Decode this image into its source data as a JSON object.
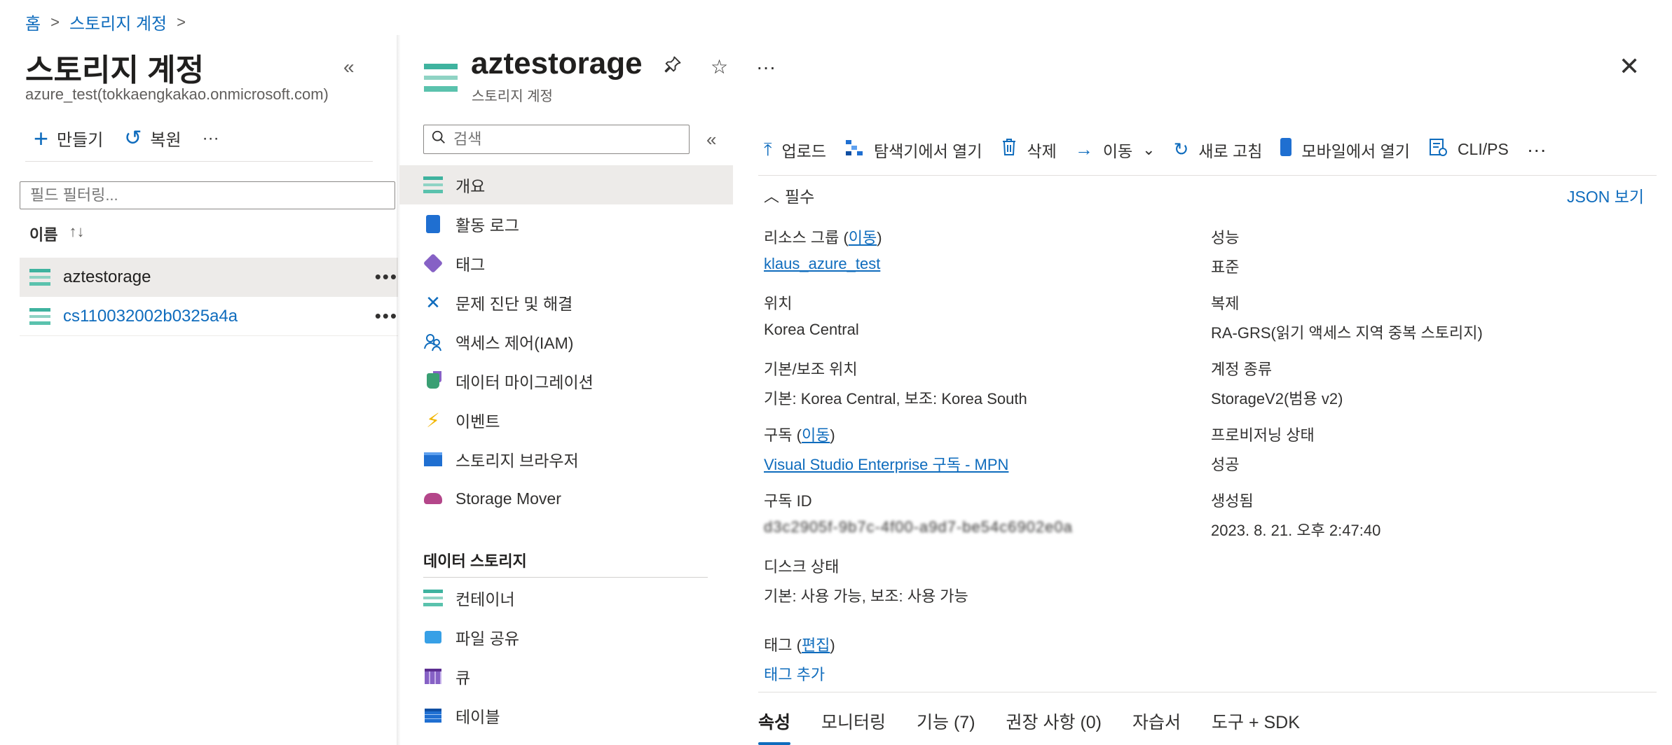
{
  "breadcrumb": {
    "home": "홈",
    "storage_accounts": "스토리지 계정"
  },
  "left_pane": {
    "title": "스토리지 계정",
    "tenant": "azure_test(tokkaengkakao.onmicrosoft.com)",
    "create_label": "만들기",
    "restore_label": "복원",
    "more": "···",
    "filter_placeholder": "필드 필터링...",
    "column_name": "이름",
    "sort_glyph": "↑↓",
    "rows": [
      {
        "name": "aztestorage",
        "more": "•••"
      },
      {
        "name": "cs110032002b0325a4a",
        "more": "•••"
      }
    ],
    "collapse": "«"
  },
  "resource": {
    "name": "aztestorage",
    "type": "스토리지 계정",
    "pin": "📌",
    "star": "☆",
    "more": "···",
    "close": "✕"
  },
  "menu": {
    "search_placeholder": "검색",
    "collapse": "«",
    "items": [
      {
        "label": "개요"
      },
      {
        "label": "활동 로그"
      },
      {
        "label": "태그"
      },
      {
        "label": "문제 진단 및 해결"
      },
      {
        "label": "액세스 제어(IAM)"
      },
      {
        "label": "데이터 마이그레이션"
      },
      {
        "label": "이벤트"
      },
      {
        "label": "스토리지 브라우저"
      },
      {
        "label": "Storage Mover"
      }
    ],
    "section_data_storage": "데이터 스토리지",
    "data_items": [
      {
        "label": "컨테이너"
      },
      {
        "label": "파일 공유"
      },
      {
        "label": "큐"
      },
      {
        "label": "테이블"
      }
    ]
  },
  "commands": {
    "upload": "업로드",
    "open_explorer": "탐색기에서 열기",
    "delete": "삭제",
    "move": "이동",
    "refresh": "새로 고침",
    "open_mobile": "모바일에서 열기",
    "cli": "CLI/PS",
    "more": "···"
  },
  "essentials": {
    "toggle": "필수",
    "json_view": "JSON 보기",
    "resource_group_label": "리소스 그룹",
    "move_link": "이동",
    "resource_group_value": "klaus_azure_test",
    "location_label": "위치",
    "location_value": "Korea Central",
    "primary_secondary_label": "기본/보조 위치",
    "primary_secondary_value": "기본: Korea Central, 보조: Korea South",
    "subscription_label": "구독",
    "subscription_value": "Visual Studio Enterprise 구독 - MPN",
    "subscription_id_label": "구독 ID",
    "subscription_id_value": "d3c2905f-9b7c-4f00-a9d7-be54c6902e0a",
    "disk_state_label": "디스크 상태",
    "disk_state_value": "기본: 사용 가능, 보조: 사용 가능",
    "performance_label": "성능",
    "performance_value": "표준",
    "replication_label": "복제",
    "replication_value": "RA-GRS(읽기 액세스 지역 중복 스토리지)",
    "account_kind_label": "계정 종류",
    "account_kind_value": "StorageV2(범용 v2)",
    "provisioning_label": "프로비저닝 상태",
    "provisioning_value": "성공",
    "created_label": "생성됨",
    "created_value": "2023. 8. 21. 오후 2:47:40",
    "tags_label": "태그",
    "edit_link": "편집",
    "add_tag": "태그 추가"
  },
  "tabs": [
    {
      "label": "속성"
    },
    {
      "label": "모니터링"
    },
    {
      "label": "기능 (7)"
    },
    {
      "label": "권장 사항 (0)"
    },
    {
      "label": "자습서"
    },
    {
      "label": "도구 + SDK"
    }
  ]
}
